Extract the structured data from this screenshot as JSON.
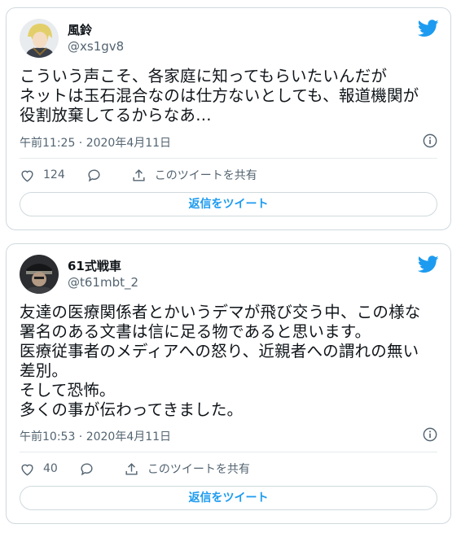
{
  "tweets": [
    {
      "name": "風鈴",
      "handle": "@xs1gv8",
      "text": "こういう声こそ、各家庭に知ってもらいたいんだが\nネットは玉石混合なのは仕方ないとしても、報道機関が\n役割放棄してるからなあ…",
      "timestamp": "午前11:25 · 2020年4月11日",
      "likes": "124",
      "share_label": "このツイートを共有",
      "reply_label": "返信をツイート"
    },
    {
      "name": "61式戦車",
      "handle": "@t61mbt_2",
      "text": "友達の医療関係者とかいうデマが飛び交う中、この様な\n署名のある文書は信に足る物であると思います。\n医療従事者のメディアへの怒り、近親者への謂れの無い\n差別。\nそして恐怖。\n多くの事が伝わってきました。",
      "timestamp": "午前10:53 · 2020年4月11日",
      "likes": "40",
      "share_label": "このツイートを共有",
      "reply_label": "返信をツイート"
    }
  ],
  "colors": {
    "accent": "#1d9bf0",
    "muted": "#536471",
    "border": "#cfd9de"
  },
  "icons": [
    "twitter-bird-icon",
    "info-icon",
    "heart-icon",
    "reply-icon",
    "share-icon"
  ]
}
